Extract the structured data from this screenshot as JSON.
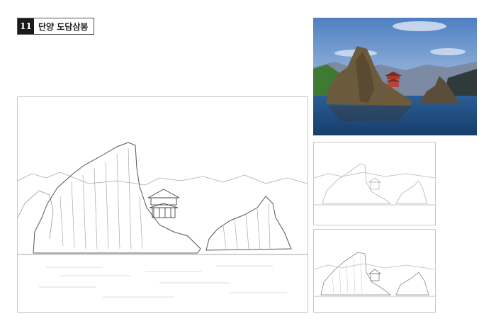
{
  "header": {
    "number": "11",
    "title": "단양 도담삼봉"
  },
  "colors": {
    "label_bg": "#1a1a1a",
    "sky": "#5b86c5",
    "water": "#1f4f8a",
    "rock": "#6b5a3c"
  },
  "icons": [
    "pavilion-icon"
  ]
}
